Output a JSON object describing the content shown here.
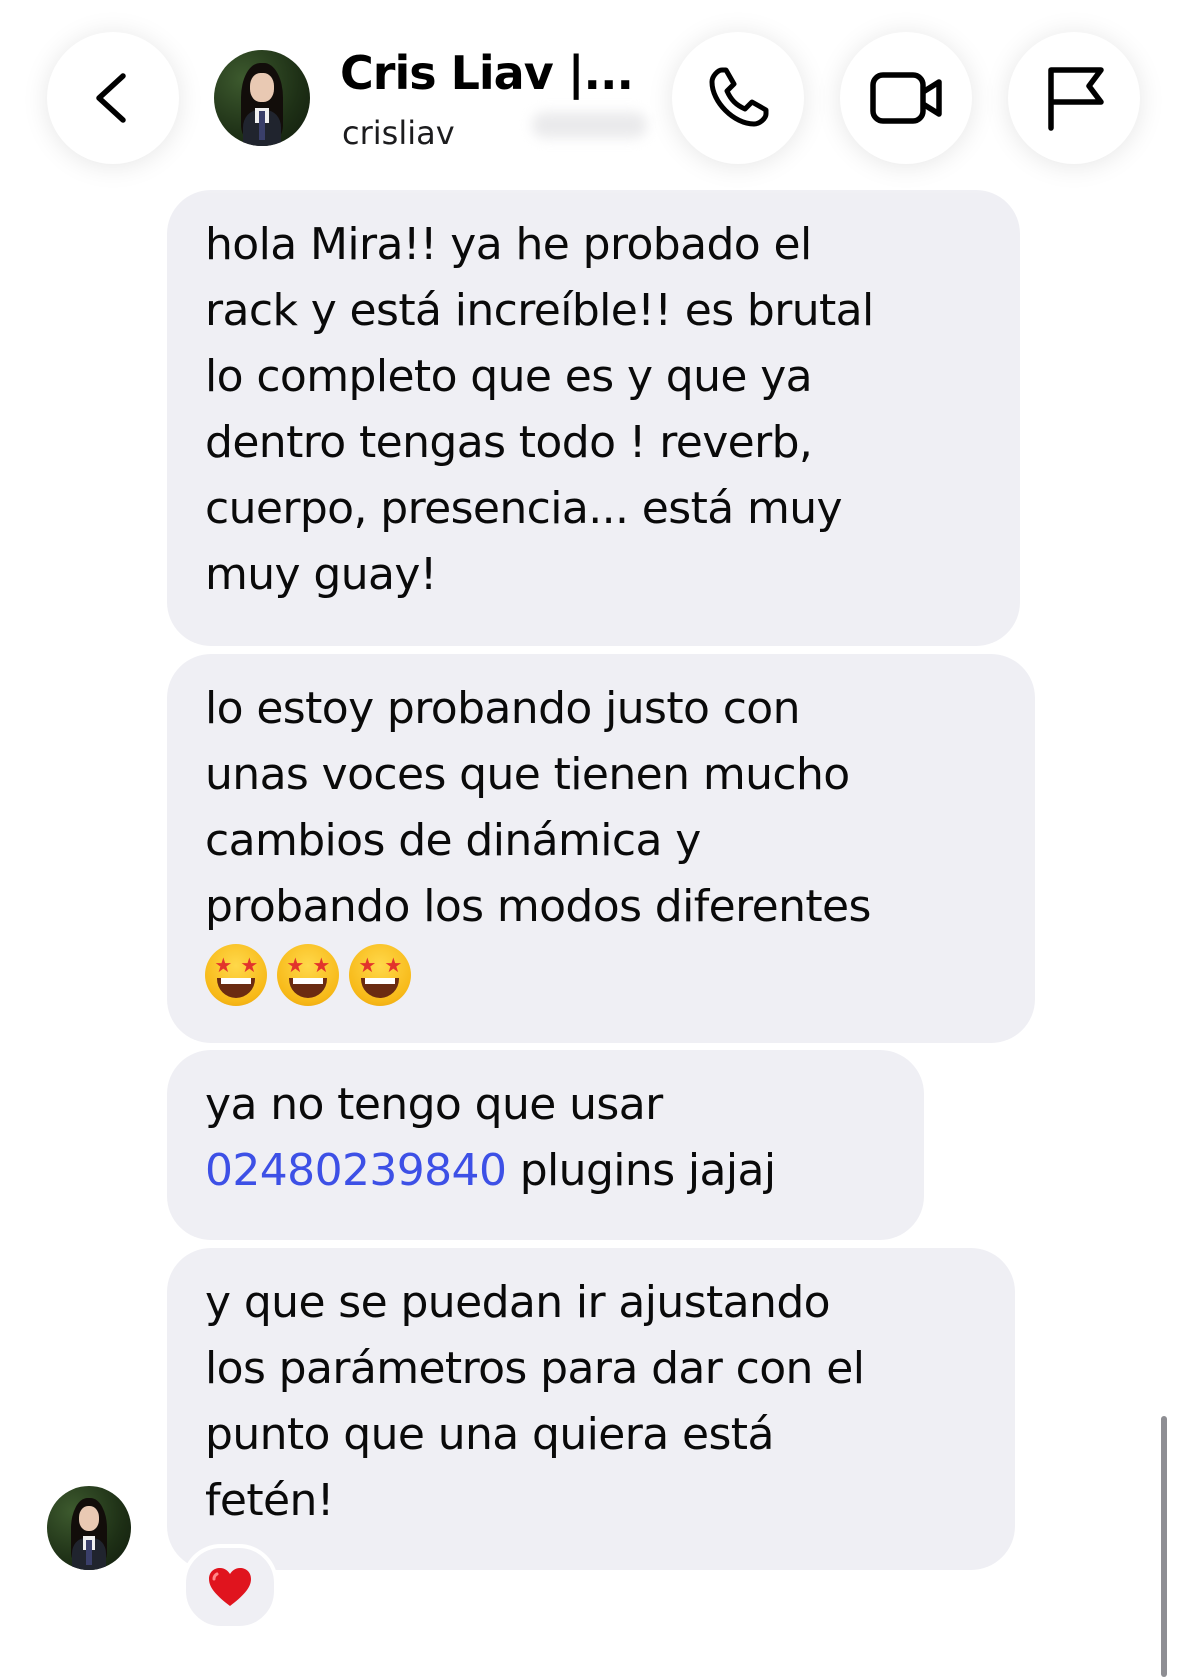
{
  "header": {
    "title": "Cris Liav |...",
    "username": "crisliav",
    "back_icon": "chevron-left-icon",
    "call_icon": "phone-icon",
    "video_icon": "video-camera-icon",
    "flag_icon": "flag-icon"
  },
  "messages": [
    {
      "lines": [
        "hola Mira!! ya he probado el",
        "rack y está increíble!! es brutal",
        "lo completo que es y que ya",
        "dentro tengas todo ! reverb,",
        "cuerpo, presencia... está muy",
        "muy guay!"
      ]
    },
    {
      "lines": [
        "lo estoy probando justo con",
        "unas voces que tienen mucho",
        "cambios de dinámica y",
        "probando los modos diferentes"
      ],
      "emojis": [
        "star-struck-emoji",
        "star-struck-emoji",
        "star-struck-emoji"
      ]
    },
    {
      "line_1": "ya no tengo que usar",
      "link": "02480239840",
      "after_link": " plugins jajaj"
    },
    {
      "lines": [
        "y que se puedan ir ajustando",
        "los parámetros para dar con el",
        "punto que una quiera está",
        "fetén!"
      ],
      "reaction": "heart-icon"
    }
  ],
  "colors": {
    "bubble_bg": "#efeff4",
    "link": "#3d50e6",
    "heart": "#e0141e",
    "text": "#0a0a0a"
  }
}
